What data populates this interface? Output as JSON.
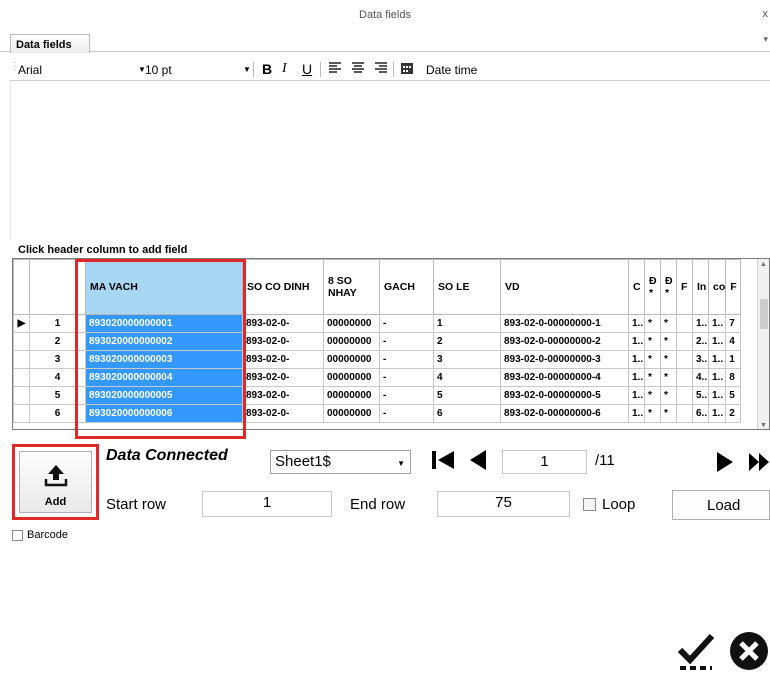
{
  "window": {
    "title": "Data fields",
    "close_glyph": "x"
  },
  "tab": {
    "label": "Data fields"
  },
  "toolbar": {
    "font": "Arial",
    "size": "10 pt",
    "bold": "B",
    "italic": "I",
    "underline": "U",
    "datetime_label": "Date time"
  },
  "grid": {
    "hint": "Click header column to add field",
    "headers": [
      "MA VACH",
      "SO CO DINH",
      "8 SO NHAY",
      "GACH",
      "SO LE",
      "VD",
      "C",
      "Đ *",
      "Đ *",
      "F",
      "In",
      "co",
      "F"
    ],
    "rows": [
      {
        "num": "1",
        "ma_vach": "893020000000001",
        "so_co_dinh": "893-02-0-",
        "nhay": "00000000",
        "gach": "-",
        "so_le": "1",
        "vd": "893-02-0-00000000-1",
        "c": "1..",
        "d1": "*",
        "d2": "*",
        "f": "",
        "in": "1..",
        "co": "1..",
        "f2": "7"
      },
      {
        "num": "2",
        "ma_vach": "893020000000002",
        "so_co_dinh": "893-02-0-",
        "nhay": "00000000",
        "gach": "-",
        "so_le": "2",
        "vd": "893-02-0-00000000-2",
        "c": "1..",
        "d1": "*",
        "d2": "*",
        "f": "",
        "in": "2..",
        "co": "1..",
        "f2": "4"
      },
      {
        "num": "3",
        "ma_vach": "893020000000003",
        "so_co_dinh": "893-02-0-",
        "nhay": "00000000",
        "gach": "-",
        "so_le": "3",
        "vd": "893-02-0-00000000-3",
        "c": "1..",
        "d1": "*",
        "d2": "*",
        "f": "",
        "in": "3..",
        "co": "1..",
        "f2": "1"
      },
      {
        "num": "4",
        "ma_vach": "893020000000004",
        "so_co_dinh": "893-02-0-",
        "nhay": "00000000",
        "gach": "-",
        "so_le": "4",
        "vd": "893-02-0-00000000-4",
        "c": "1..",
        "d1": "*",
        "d2": "*",
        "f": "",
        "in": "4..",
        "co": "1..",
        "f2": "8"
      },
      {
        "num": "5",
        "ma_vach": "893020000000005",
        "so_co_dinh": "893-02-0-",
        "nhay": "00000000",
        "gach": "-",
        "so_le": "5",
        "vd": "893-02-0-00000000-5",
        "c": "1..",
        "d1": "*",
        "d2": "*",
        "f": "",
        "in": "5..",
        "co": "1..",
        "f2": "5"
      },
      {
        "num": "6",
        "ma_vach": "893020000000006",
        "so_co_dinh": "893-02-0-",
        "nhay": "00000000",
        "gach": "-",
        "so_le": "6",
        "vd": "893-02-0-00000000-6",
        "c": "1..",
        "d1": "*",
        "d2": "*",
        "f": "",
        "in": "6..",
        "co": "1..",
        "f2": "2"
      }
    ],
    "selected_color": "#3399ff"
  },
  "connection": {
    "status": "Data Connected",
    "sheet": "Sheet1$",
    "page": "1",
    "page_total": "/11",
    "start_label": "Start row",
    "start_value": "1",
    "end_label": "End row",
    "end_value": "75",
    "loop_label": "Loop",
    "load_label": "Load"
  },
  "add_button": {
    "label": "Add"
  },
  "barcode": {
    "label": "Barcode"
  },
  "highlight_color": "#e0282a"
}
